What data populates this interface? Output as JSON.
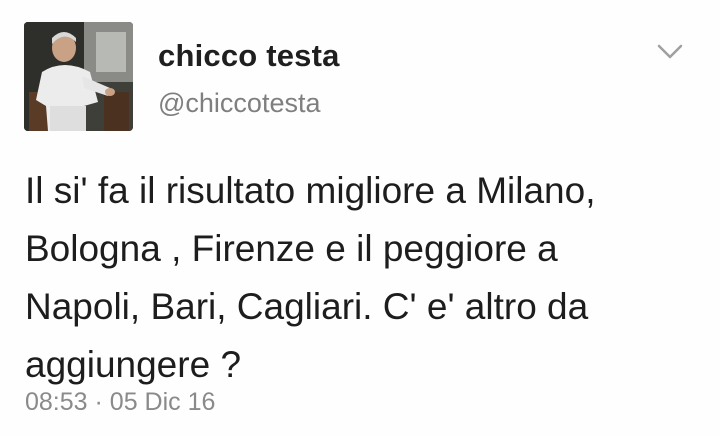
{
  "tweet": {
    "author": {
      "name": "chicco testa",
      "handle": "@chiccotesta"
    },
    "text": "Il si' fa il risultato migliore a Milano,\nBologna , Firenze e il peggiore a\nNapoli, Bari, Cagliari. C' e' altro da\naggiungere ?",
    "time": "08:53",
    "separator": "·",
    "date": "05 Dic 16"
  },
  "icons": {
    "menu": "chevron-down-icon"
  },
  "colors": {
    "name": "#1f1f1f",
    "handle": "#7f7f7f",
    "body_text": "#1d1d1d",
    "meta": "#8a8a8a",
    "caret": "#a0a0a0"
  }
}
